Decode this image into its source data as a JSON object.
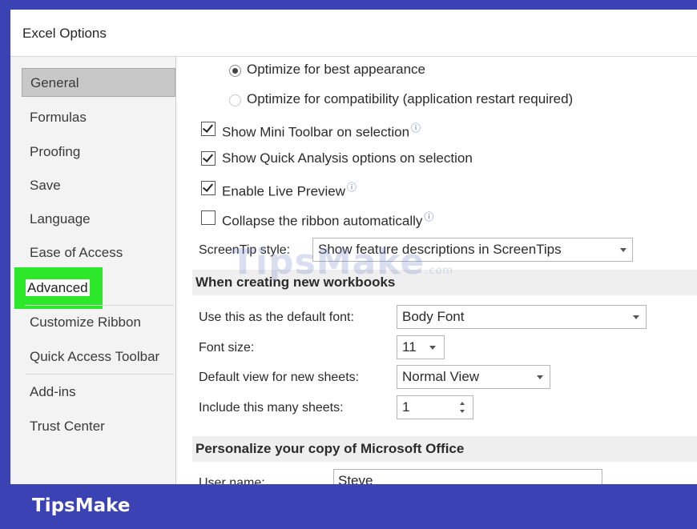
{
  "window": {
    "title": "Excel Options"
  },
  "sidebar": {
    "items": [
      {
        "label": "General"
      },
      {
        "label": "Formulas"
      },
      {
        "label": "Proofing"
      },
      {
        "label": "Save"
      },
      {
        "label": "Language"
      },
      {
        "label": "Ease of Access"
      },
      {
        "label": "Advanced"
      },
      {
        "label": "Customize Ribbon"
      },
      {
        "label": "Quick Access Toolbar"
      },
      {
        "label": "Add-ins"
      },
      {
        "label": "Trust Center"
      }
    ],
    "selected": "General",
    "highlighted": "Advanced"
  },
  "options": {
    "radio_best_appearance": {
      "label": "Optimize for best appearance",
      "selected": true
    },
    "radio_compatibility": {
      "label": "Optimize for compatibility (application restart required)",
      "selected": false
    },
    "mini_toolbar": {
      "label": "Show Mini Toolbar on selection",
      "checked": true
    },
    "quick_analysis": {
      "label": "Show Quick Analysis options on selection",
      "checked": true
    },
    "live_preview": {
      "label": "Enable Live Preview",
      "checked": true
    },
    "collapse_ribbon": {
      "label": "Collapse the ribbon automatically",
      "checked": false
    },
    "screentip_label": "ScreenTip style:",
    "screentip_value": "Show feature descriptions in ScreenTips"
  },
  "new_workbooks": {
    "heading": "When creating new workbooks",
    "default_font_label": "Use this as the default font:",
    "default_font_value": "Body Font",
    "font_size_label": "Font size:",
    "font_size_value": "11",
    "default_view_label": "Default view for new sheets:",
    "default_view_value": "Normal View",
    "sheets_label": "Include this many sheets:",
    "sheets_value": "1"
  },
  "personalize": {
    "heading": "Personalize your copy of Microsoft Office",
    "username_label": "User name:",
    "username_value": "Steve"
  },
  "info_glyph": "ⓘ",
  "watermark": {
    "text": "TipsMake",
    "suffix": ".com"
  },
  "footer": {
    "brand": "TipsMake"
  },
  "colors": {
    "frame": "#3a42b4",
    "highlight": "#2de82a",
    "selected": "#c8c8c8"
  }
}
